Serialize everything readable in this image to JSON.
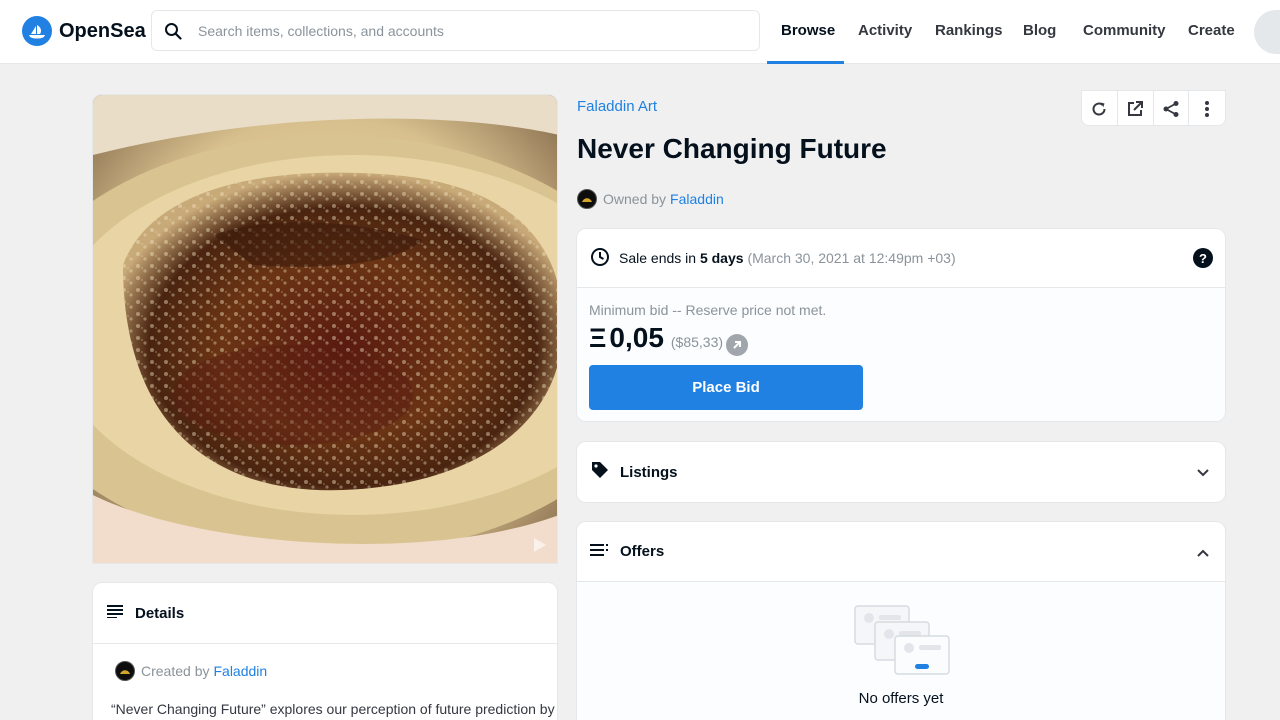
{
  "header": {
    "brand": "OpenSea",
    "search_placeholder": "Search items, collections, and accounts",
    "nav": [
      "Browse",
      "Activity",
      "Rankings",
      "Blog",
      "Community",
      "Create"
    ],
    "active_nav": "Browse",
    "accent_color": "#2081e2"
  },
  "item": {
    "collection": "Faladdin Art",
    "title": "Never Changing Future",
    "owned_by_label": "Owned by",
    "owner": "Faladdin"
  },
  "sale": {
    "ends_prefix": "Sale ends in",
    "ends_in": "5 days",
    "ends_date": "(March 30, 2021 at 12:49pm +03)",
    "help_icon_text": "?",
    "min_bid_label": "Minimum bid -- Reserve price not met.",
    "currency_symbol": "Ξ",
    "price": "0,05",
    "price_usd": "($85,33)",
    "bid_button": "Place Bid"
  },
  "panels": {
    "listings": "Listings",
    "offers": "Offers",
    "no_offers": "No offers yet"
  },
  "details": {
    "heading": "Details",
    "created_by_label": "Created by",
    "creator": "Faladdin",
    "description": "“Never Changing Future” explores our perception of future prediction by"
  },
  "icons": {
    "search": "search-icon",
    "refresh": "refresh-icon",
    "external": "external-link-icon",
    "share": "share-icon",
    "more": "more-vertical-icon",
    "clock": "clock-icon",
    "tag": "tag-icon",
    "offers": "list-icon",
    "details": "details-lines-icon",
    "play": "play-icon"
  }
}
